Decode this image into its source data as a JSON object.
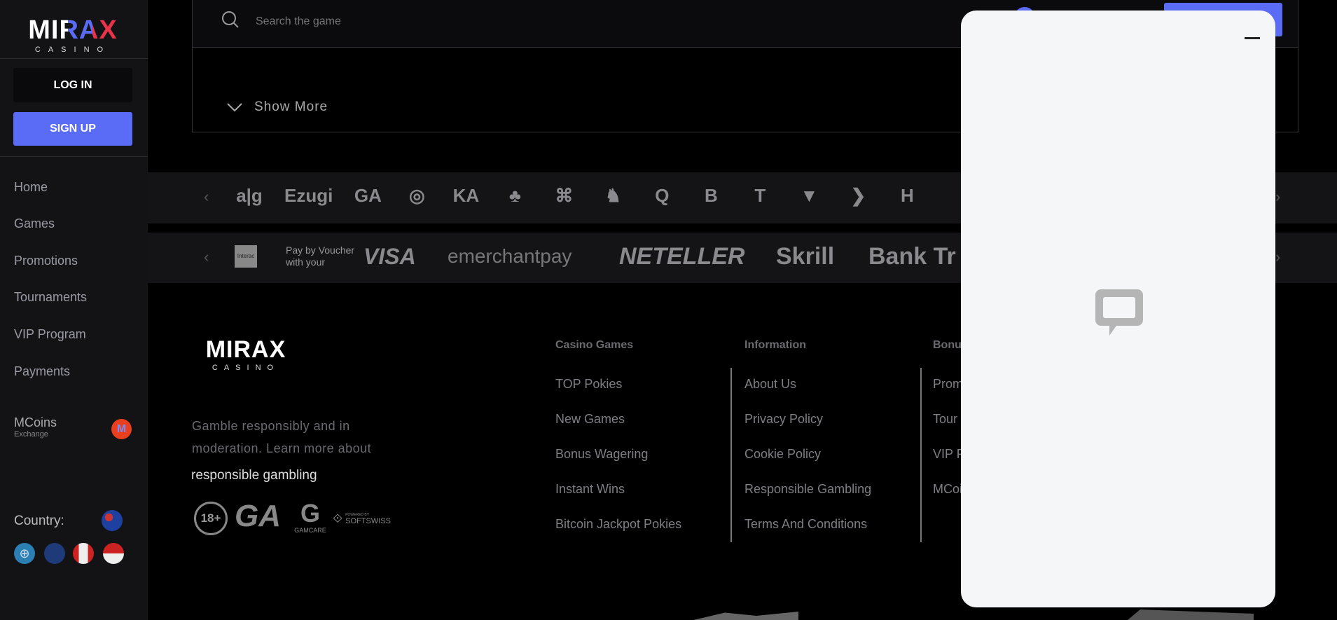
{
  "brand": {
    "logo": "MIRAX",
    "logo_sub": "CASINO"
  },
  "sidebar": {
    "login": "LOG IN",
    "signup": "SIGN UP",
    "items": [
      {
        "label": "Home"
      },
      {
        "label": "Games"
      },
      {
        "label": "Promotions"
      },
      {
        "label": "Tournaments"
      },
      {
        "label": "VIP Program"
      },
      {
        "label": "Payments"
      }
    ],
    "mcoins": {
      "label": "MCoins",
      "sub": "Exchange"
    },
    "country_label": "Country:"
  },
  "search": {
    "placeholder": "Search the game"
  },
  "show_more": "Show More",
  "providers": [
    "a|g",
    "Ezugi",
    "GA",
    "◎",
    "KA",
    "♣",
    "⌘",
    "♞",
    "Q",
    "B",
    "T",
    "▼",
    "❯",
    "H"
  ],
  "payments": {
    "interac": "Interac",
    "voucher_line1": "Pay by Voucher",
    "voucher_line2": "with your",
    "items": [
      "VISA",
      "emerchantpay",
      "NETELLER",
      "Skrill",
      "Bank Tr"
    ]
  },
  "footer": {
    "text": "Gamble responsibly and in moderation. Learn more about",
    "link": "responsible gambling",
    "badges": {
      "age": "18+",
      "ga": "GA",
      "gamcare": "GAMCARE",
      "softswiss_top": "POWERED BY",
      "softswiss": "SOFTSWISS"
    },
    "columns": [
      {
        "title": "Casino Games",
        "items": [
          "TOP Pokies",
          "New Games",
          "Bonus Wagering",
          "Instant Wins",
          "Bitcoin Jackpot Pokies"
        ]
      },
      {
        "title": "Information",
        "items": [
          "About Us",
          "Privacy Policy",
          "Cookie Policy",
          "Responsible Gambling",
          "Terms And Conditions"
        ]
      },
      {
        "title": "Bonu",
        "items": [
          "Prom",
          "Tour",
          "VIP P",
          "MCoi"
        ]
      }
    ]
  },
  "colors": {
    "accent": "#5a6cf5",
    "sidebar_bg": "#131316",
    "chat_bg": "#f5f6f8"
  },
  "icons": {
    "search": "search-icon",
    "chevron": "chevron-down-icon",
    "chat": "livechat-icon",
    "minimize": "minimize-icon"
  }
}
